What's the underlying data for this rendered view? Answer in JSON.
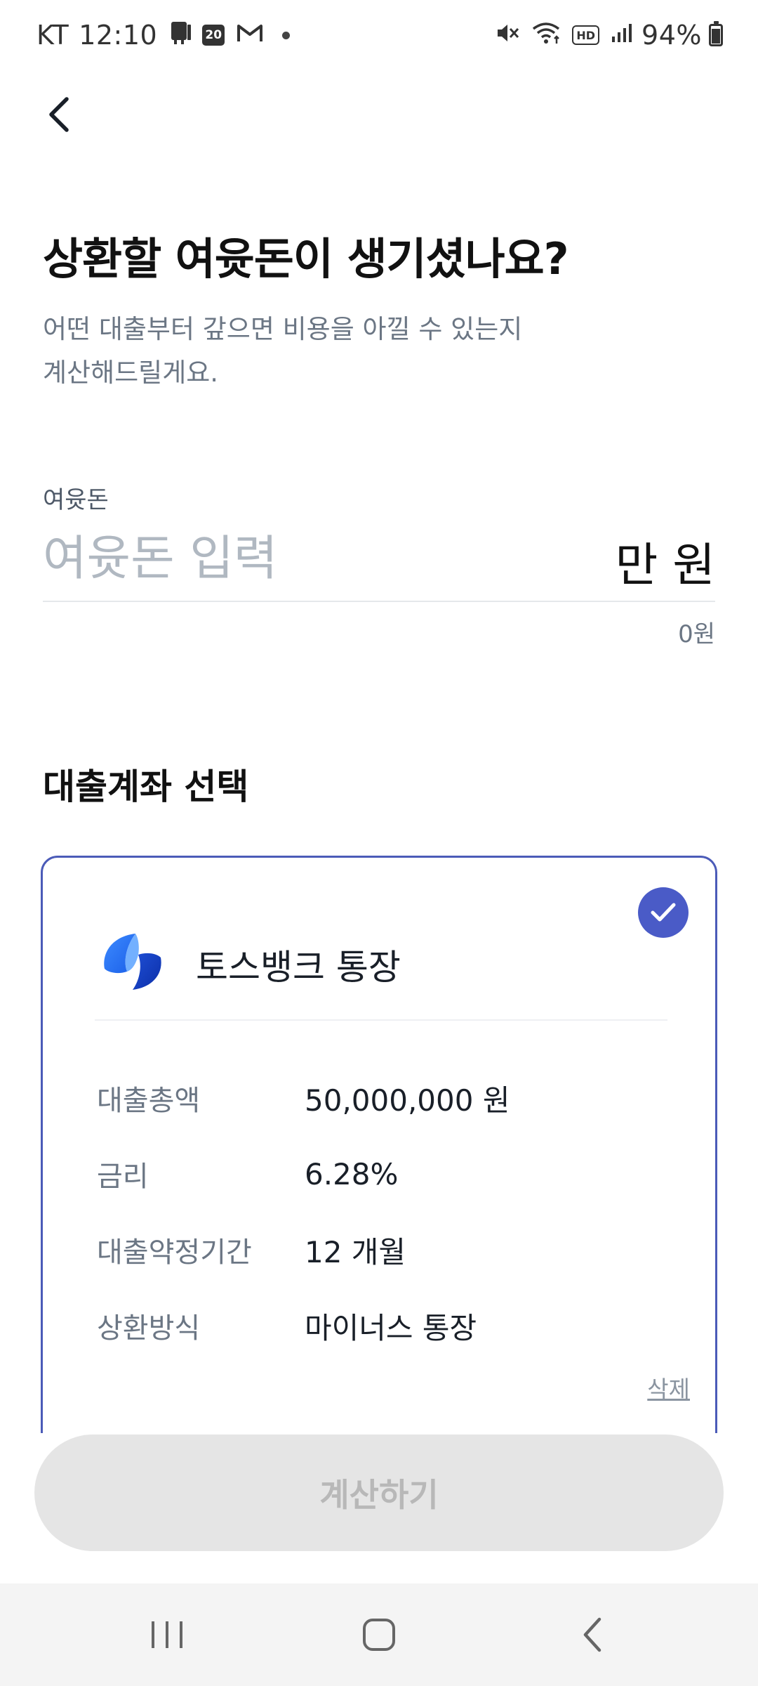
{
  "status_bar": {
    "carrier": "KT",
    "time": "12:10",
    "calendar_day": "20",
    "hd_label": "HD",
    "battery": "94%"
  },
  "header": {
    "back_icon": "chevron-left-icon"
  },
  "main": {
    "title": "상환할 여윳돈이 생기셨나요?",
    "subtitle": "어떤 대출부터 갚으면 비용을 아낄 수 있는지\n계산해드릴게요.",
    "amount": {
      "label": "여윳돈",
      "placeholder": "여윳돈 입력",
      "value": "",
      "unit": "만 원",
      "won_display": "0원"
    },
    "section_title": "대출계좌 선택",
    "loan_card": {
      "selected": true,
      "bank_name": "토스뱅크 통장",
      "details": [
        {
          "key": "대출총액",
          "value": "50,000,000 원"
        },
        {
          "key": "금리",
          "value": "6.28%"
        },
        {
          "key": "대출약정기간",
          "value": "12 개월"
        },
        {
          "key": "상환방식",
          "value": "마이너스 통장"
        }
      ],
      "delete_label": "삭제"
    },
    "calculate_label": "계산하기"
  },
  "colors": {
    "accent": "#4a5bc7",
    "card_border": "#4b5bb8",
    "disabled_button_bg": "#e5e5e5",
    "disabled_button_text": "#b8b8b8"
  }
}
